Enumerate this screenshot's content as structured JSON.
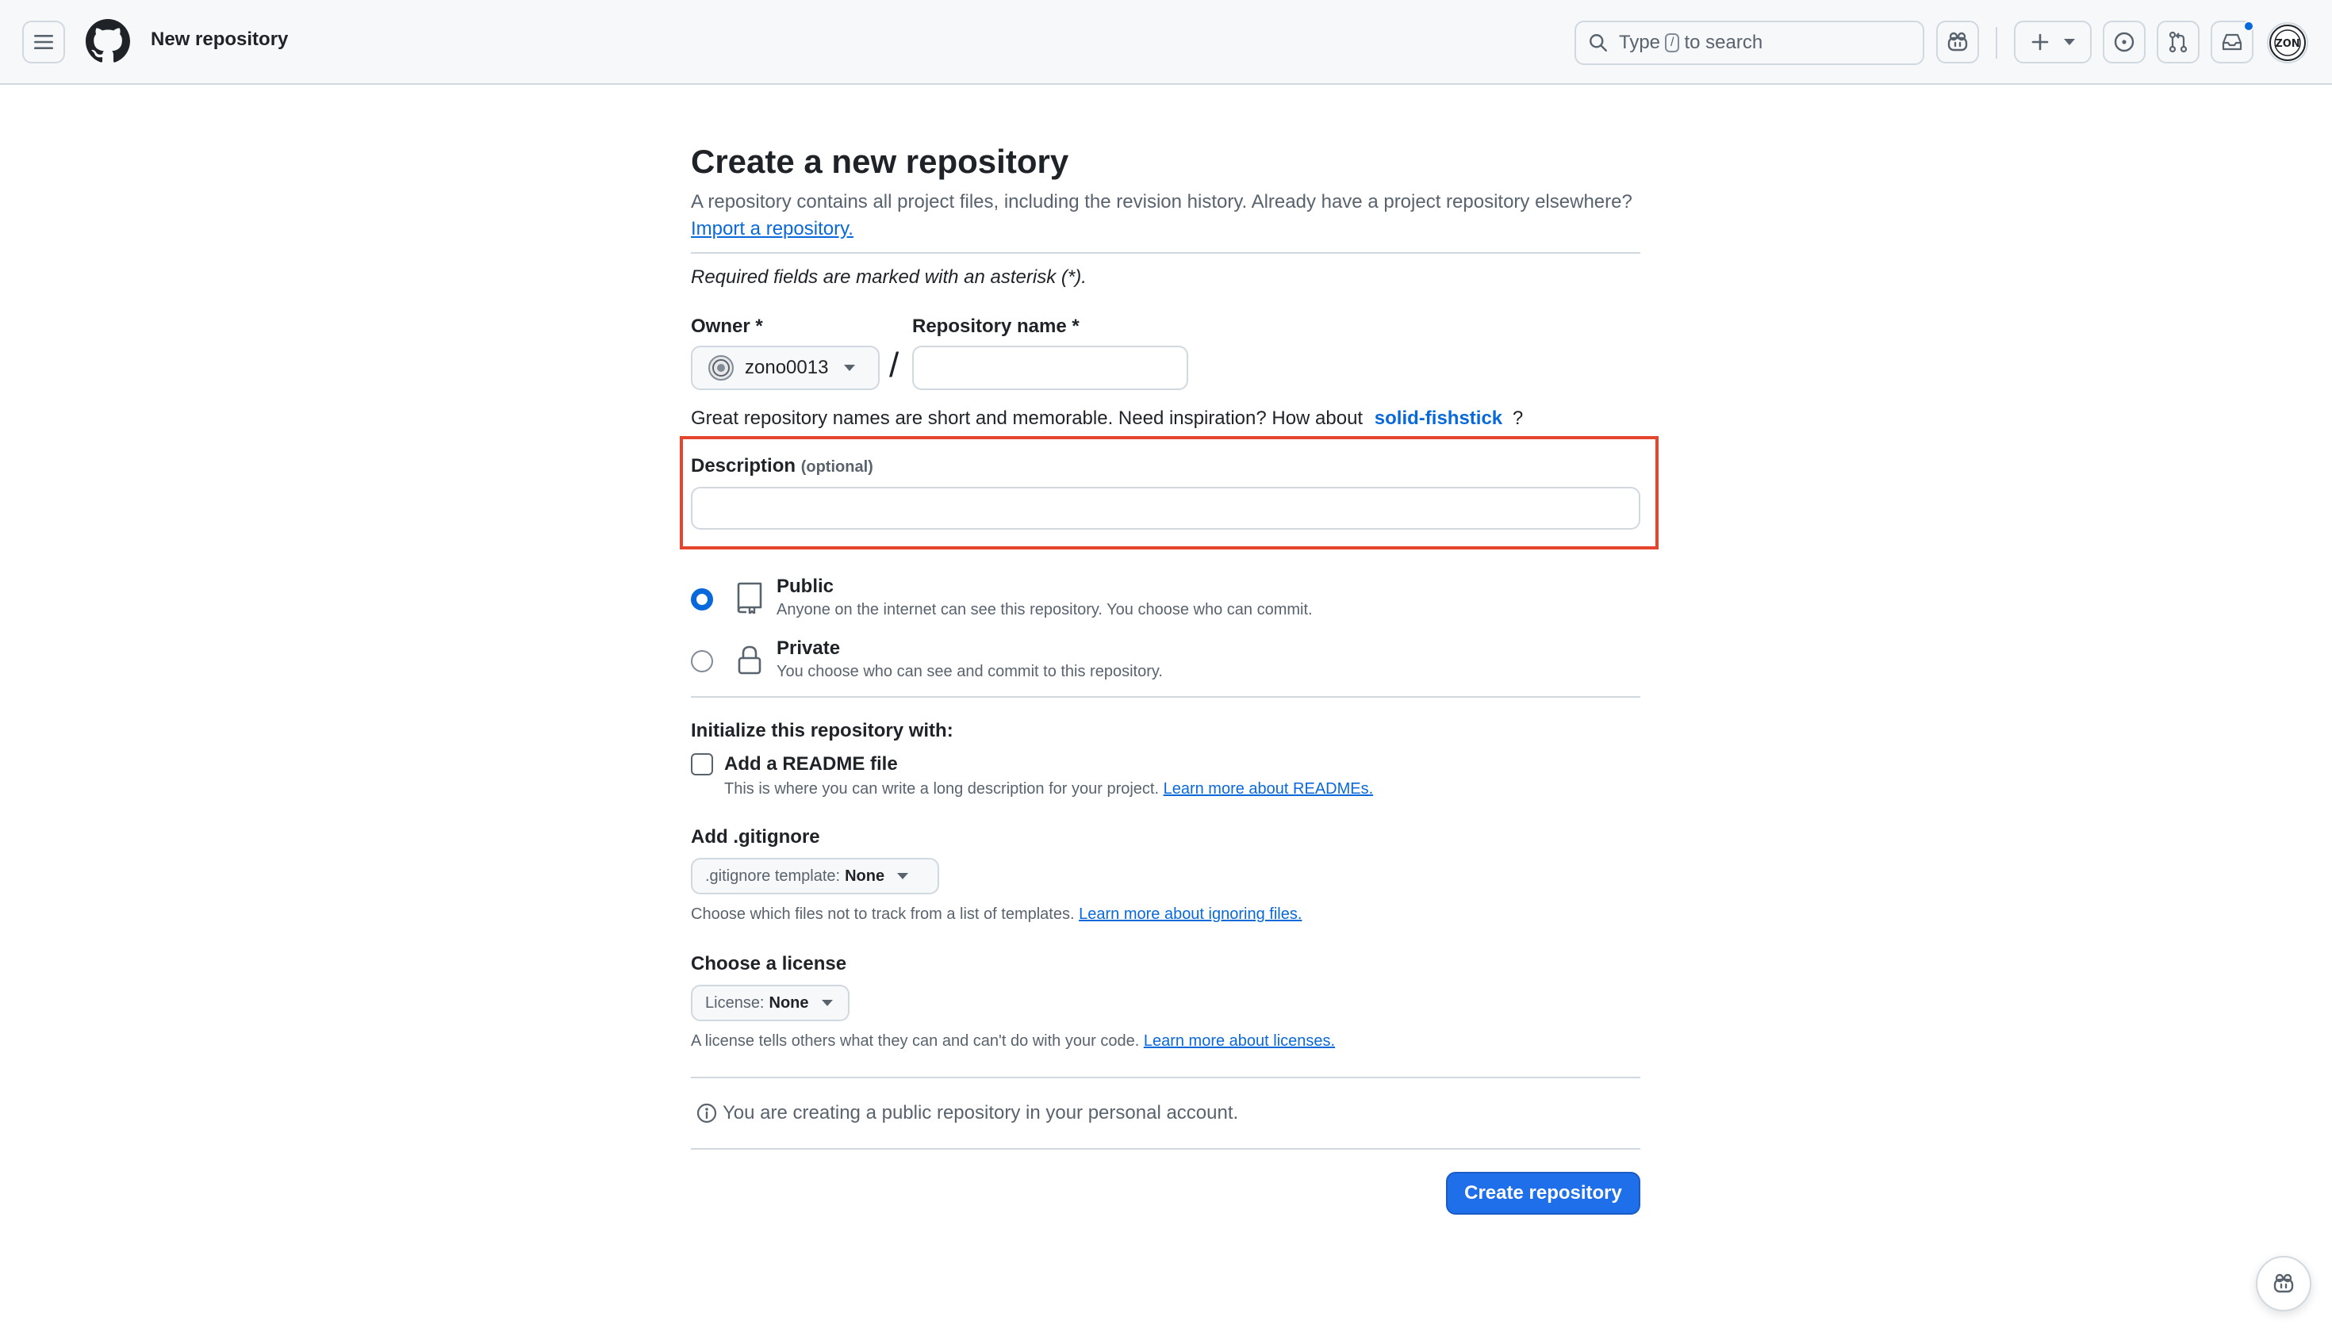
{
  "header": {
    "title": "New repository",
    "search_prefix": "Type",
    "search_key": "/",
    "search_suffix": "to search",
    "avatar_text": "ZON"
  },
  "page": {
    "title": "Create a new repository",
    "subtitle": "A repository contains all project files, including the revision history. Already have a project repository elsewhere?",
    "import_link": "Import a repository.",
    "required_note": "Required fields are marked with an asterisk (*)."
  },
  "form": {
    "owner_label": "Owner *",
    "owner_value": "zono0013",
    "repo_name_label": "Repository name *",
    "repo_name_value": "",
    "slash": "/",
    "inspiration_text": "Great repository names are short and memorable. Need inspiration? How about",
    "inspiration_suggestion": "solid-fishstick",
    "inspiration_end": "?",
    "description_label": "Description",
    "description_optional": "(optional)",
    "description_value": ""
  },
  "visibility": {
    "public_title": "Public",
    "public_desc": "Anyone on the internet can see this repository. You choose who can commit.",
    "private_title": "Private",
    "private_desc": "You choose who can see and commit to this repository.",
    "selected": "Public"
  },
  "initialize": {
    "heading": "Initialize this repository with:",
    "readme_label": "Add a README file",
    "readme_desc": "This is where you can write a long description for your project.",
    "readme_link": "Learn more about READMEs.",
    "readme_checked": false
  },
  "gitignore": {
    "heading": "Add .gitignore",
    "select_prefix": ".gitignore template:",
    "select_value": "None",
    "desc": "Choose which files not to track from a list of templates.",
    "link": "Learn more about ignoring files."
  },
  "license": {
    "heading": "Choose a license",
    "select_prefix": "License:",
    "select_value": "None",
    "desc": "A license tells others what they can and can't do with your code.",
    "link": "Learn more about licenses."
  },
  "footer": {
    "info": "You are creating a public repository in your personal account.",
    "create_button": "Create repository"
  },
  "colors": {
    "accent": "#0969da",
    "primary_button": "#1f6feb",
    "highlight": "#e5452d",
    "border": "#d1d9e0"
  },
  "icons": {
    "hamburger": "three-bars-icon",
    "logo": "github-mark-icon",
    "search": "search-icon",
    "copilot": "copilot-icon",
    "plus": "plus-icon",
    "issues": "issue-opened-icon",
    "pulls": "git-pull-request-icon",
    "inbox": "inbox-icon",
    "repo": "repo-icon",
    "lock": "lock-icon",
    "info": "info-icon"
  }
}
